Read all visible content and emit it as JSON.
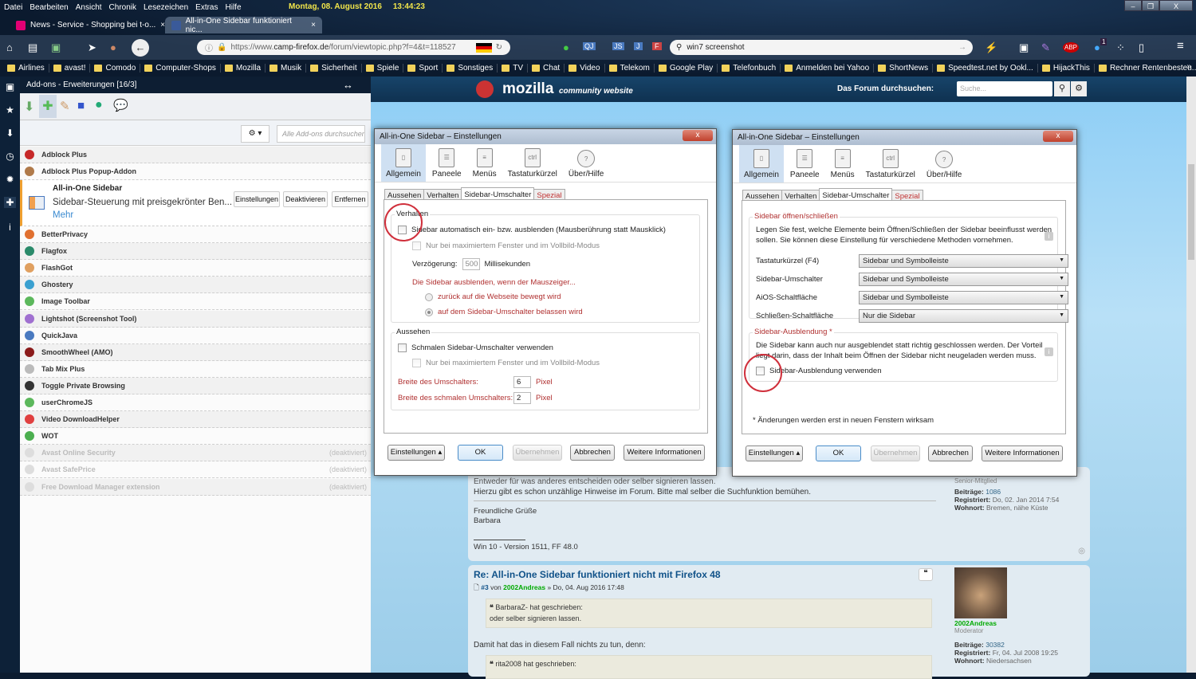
{
  "menu": [
    "Datei",
    "Bearbeiten",
    "Ansicht",
    "Chronik",
    "Lesezeichen",
    "Extras",
    "Hilfe"
  ],
  "clock": {
    "date": "Montag, 08. August 2016",
    "time": "13:44:23"
  },
  "window_controls": {
    "minimize": "–",
    "restore": "❐",
    "close": "X"
  },
  "tabs": [
    {
      "title": "News - Service - Shopping bei t-o...",
      "favicon_color": "#e20074"
    },
    {
      "title": "All-in-One Sidebar funktioniert nic...",
      "favicon_color": "#3a5a9a"
    }
  ],
  "tab_close": "×",
  "urlbar": {
    "prefix": "https://www.",
    "domain": "camp-firefox.de",
    "path": "/forum/viewtopic.php?f=4&t=118527"
  },
  "search": {
    "value": "win7 screenshot"
  },
  "toolbar_badge": "1",
  "bookmarks": [
    "Airlines",
    "avast!",
    "Comodo",
    "Computer-Shops",
    "Mozilla",
    "Musik",
    "Sicherheit",
    "Spiele",
    "Sport",
    "Sonstiges",
    "TV",
    "Chat",
    "Video",
    "Telekom",
    "Google Play",
    "Telefonbuch",
    "Anmelden bei Yahoo",
    "ShortNews",
    "Speedtest.net by Ookl...",
    "HijackThis",
    "Rechner Rentenbesteu..."
  ],
  "bookmarks_overflow": "»",
  "sidebar": {
    "title": "Add-ons - Erweiterungen [16/3]",
    "search_placeholder": "Alle Add-ons durchsuchen",
    "gear": "⚙ ▾",
    "selected": {
      "name": "All-in-One Sidebar",
      "description": "Sidebar-Steuerung mit preisgekrönter Ben...",
      "more": "Mehr",
      "buttons": [
        "Einstellungen",
        "Deaktivieren",
        "Entfernen"
      ]
    },
    "addons_top": [
      {
        "name": "Adblock Plus",
        "color": "#c62828"
      },
      {
        "name": "Adblock Plus Popup-Addon",
        "color": "#b07a4a"
      }
    ],
    "addons": [
      {
        "name": "BetterPrivacy",
        "color": "#e07030"
      },
      {
        "name": "Flagfox",
        "color": "#2a8a6a"
      },
      {
        "name": "FlashGot",
        "color": "#e0a060"
      },
      {
        "name": "Ghostery",
        "color": "#3aa0d0"
      },
      {
        "name": "Image Toolbar",
        "color": "#5cb85c"
      },
      {
        "name": "Lightshot (Screenshot Tool)",
        "color": "#a070d0"
      },
      {
        "name": "QuickJava",
        "color": "#4a7ac0"
      },
      {
        "name": "SmoothWheel (AMO)",
        "color": "#8a1a1a"
      },
      {
        "name": "Tab Mix Plus",
        "color": "#bbbbbb"
      },
      {
        "name": "Toggle Private Browsing",
        "color": "#333333"
      },
      {
        "name": "userChromeJS",
        "color": "#5cb85c"
      },
      {
        "name": "Video DownloadHelper",
        "color": "#e04040"
      },
      {
        "name": "WOT",
        "color": "#4caf50"
      }
    ],
    "disabled": [
      {
        "name": "Avast Online Security",
        "status": "(deaktiviert)"
      },
      {
        "name": "Avast SafePrice",
        "status": "(deaktiviert)"
      },
      {
        "name": "Free Download Manager extension",
        "status": "(deaktiviert)"
      }
    ]
  },
  "forum": {
    "logo": "mozilla",
    "logo_sub": "community website",
    "search_label": "Das Forum durchsuchen:",
    "search_placeholder": "Suche...",
    "post2": {
      "partial": "Entweder für was anderes entscheiden oder selber signieren lassen.",
      "text": "Hierzu gibt es schon unzählige Hinweise im Forum. Bitte mal selber die Suchfunktion bemühen.",
      "greeting": "Freundliche Grüße",
      "name": "Barbara",
      "signature": "Win 10 - Version 1511, FF 48.0",
      "rank": "Senior-Mitglied",
      "posts_label": "Beiträge:",
      "posts": "1086",
      "reg_label": "Registriert:",
      "reg": "Do, 02. Jan 2014 7:54",
      "loc_label": "Wohnort:",
      "loc": "Bremen, nähe Küste"
    },
    "post3": {
      "title": "Re: All-in-One Sidebar funktioniert nicht mit Firefox 48",
      "num": "#3",
      "by": "von",
      "author": "2002Andreas",
      "date": "» Do, 04. Aug 2016 17:48",
      "quote1_author": "BarbaraZ- hat geschrieben:",
      "quote1": "oder selber signieren lassen.",
      "text": "Damit hat das in diesem Fall nichts zu tun, denn:",
      "quote2_author": "rita2008 hat geschrieben:",
      "rank": "Moderator",
      "posts": "30382",
      "reg": "Fr, 04. Jul 2008 19:25",
      "loc": "Niedersachsen"
    }
  },
  "dialog": {
    "title": "All-in-One Sidebar – Einstellungen",
    "close": "x",
    "toolbar": [
      "Allgemein",
      "Paneele",
      "Menüs",
      "Tastaturkürzel",
      "Über/Hilfe"
    ],
    "tabs": [
      "Aussehen",
      "Verhalten",
      "Sidebar-Umschalter",
      "Spezial"
    ],
    "buttons": {
      "settings": "Einstellungen ▴",
      "ok": "OK",
      "apply": "Übernehmen",
      "cancel": "Abbrechen",
      "more": "Weitere Informationen"
    }
  },
  "dialog1": {
    "g1": "Verhalten",
    "auto": "Sidebar automatisch ein- bzw. ausblenden (Mausberührung statt Mausklick)",
    "only_max": "Nur bei maximiertem Fenster und im Vollbild-Modus",
    "delay_label": "Verzögerung:",
    "delay": "500",
    "delay_unit": "Millisekunden",
    "hide_when": "Die Sidebar ausblenden, wenn der Mauszeiger...",
    "r1": "zurück auf die Webseite bewegt wird",
    "r2": "auf dem Sidebar-Umschalter belassen wird",
    "g2": "Aussehen",
    "narrow": "Schmalen Sidebar-Umschalter verwenden",
    "only_max2": "Nur bei maximiertem Fenster und im Vollbild-Modus",
    "w1_label": "Breite des Umschalters:",
    "w1": "6",
    "w2_label": "Breite des schmalen Umschalters:",
    "w2": "2",
    "unit": "Pixel"
  },
  "dialog2": {
    "g1": "Sidebar öffnen/schließen",
    "desc1": "Legen Sie fest, welche Elemente beim Öffnen/Schließen der Sidebar beeinflusst werden",
    "desc2": "sollen. Sie können diese Einstellung für verschiedene Methoden vornehmen.",
    "rows": [
      {
        "label": "Tastaturkürzel (F4)",
        "value": "Sidebar und Symbolleiste"
      },
      {
        "label": "Sidebar-Umschalter",
        "value": "Sidebar und Symbolleiste"
      },
      {
        "label": "AiOS-Schaltfläche",
        "value": "Sidebar und Symbolleiste"
      },
      {
        "label": "Schließen-Schaltfläche",
        "value": "Nur die Sidebar"
      }
    ],
    "g2": "Sidebar-Ausblendung *",
    "desc3": "Die Sidebar kann auch nur ausgeblendet statt richtig geschlossen werden. Der Vorteil",
    "desc4": "liegt darin, dass der Inhalt beim Öffnen der Sidebar nicht neugeladen werden muss.",
    "use": "Sidebar-Ausblendung verwenden",
    "note": "* Änderungen werden erst in neuen Fenstern wirksam"
  }
}
